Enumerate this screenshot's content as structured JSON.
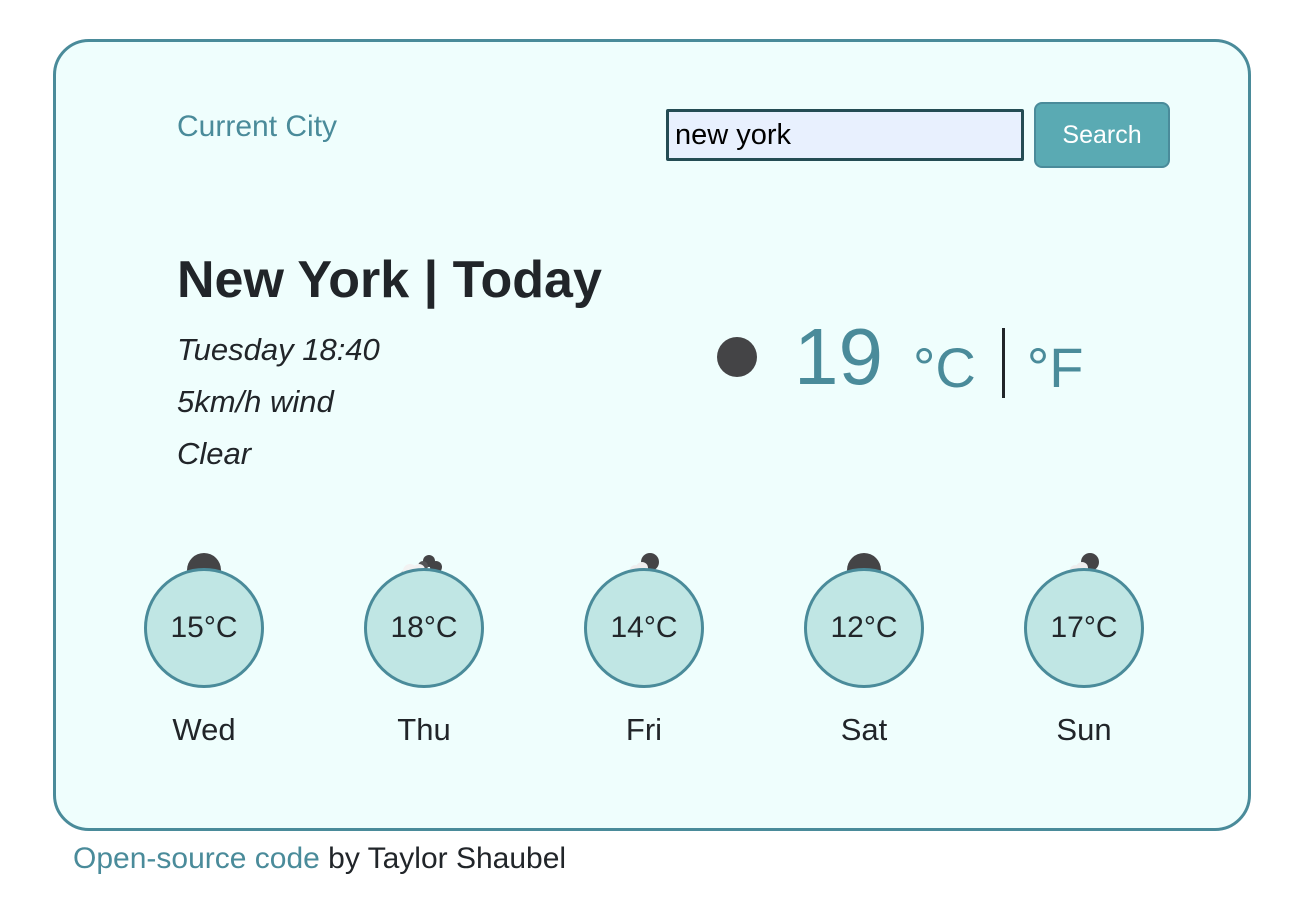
{
  "header": {
    "current_city_label": "Current City",
    "search": {
      "value": "new york",
      "placeholder": "",
      "button_label": "Search"
    }
  },
  "weather": {
    "heading": "New York | Today",
    "datetime": "Tuesday 18:40",
    "wind": "5km/h wind",
    "description": "Clear",
    "icon": "clear-night-icon",
    "temperature": "19",
    "unit_celsius": "°C",
    "unit_fahrenheit": "°F"
  },
  "forecast": [
    {
      "day": "Wed",
      "temp": "15°C",
      "icon": "clear-night-icon"
    },
    {
      "day": "Thu",
      "temp": "18°C",
      "icon": "cloudy-night-icon"
    },
    {
      "day": "Fri",
      "temp": "14°C",
      "icon": "rain-night-icon"
    },
    {
      "day": "Sat",
      "temp": "12°C",
      "icon": "clear-night-icon"
    },
    {
      "day": "Sun",
      "temp": "17°C",
      "icon": "rain-night-icon"
    }
  ],
  "footer": {
    "link_text": "Open-source code",
    "byline": " by Taylor Shaubel"
  },
  "colors": {
    "accent": "#4a8b9a",
    "card_background": "#effefd",
    "circle_fill": "#c0e6e4",
    "button": "#5aaab3"
  }
}
